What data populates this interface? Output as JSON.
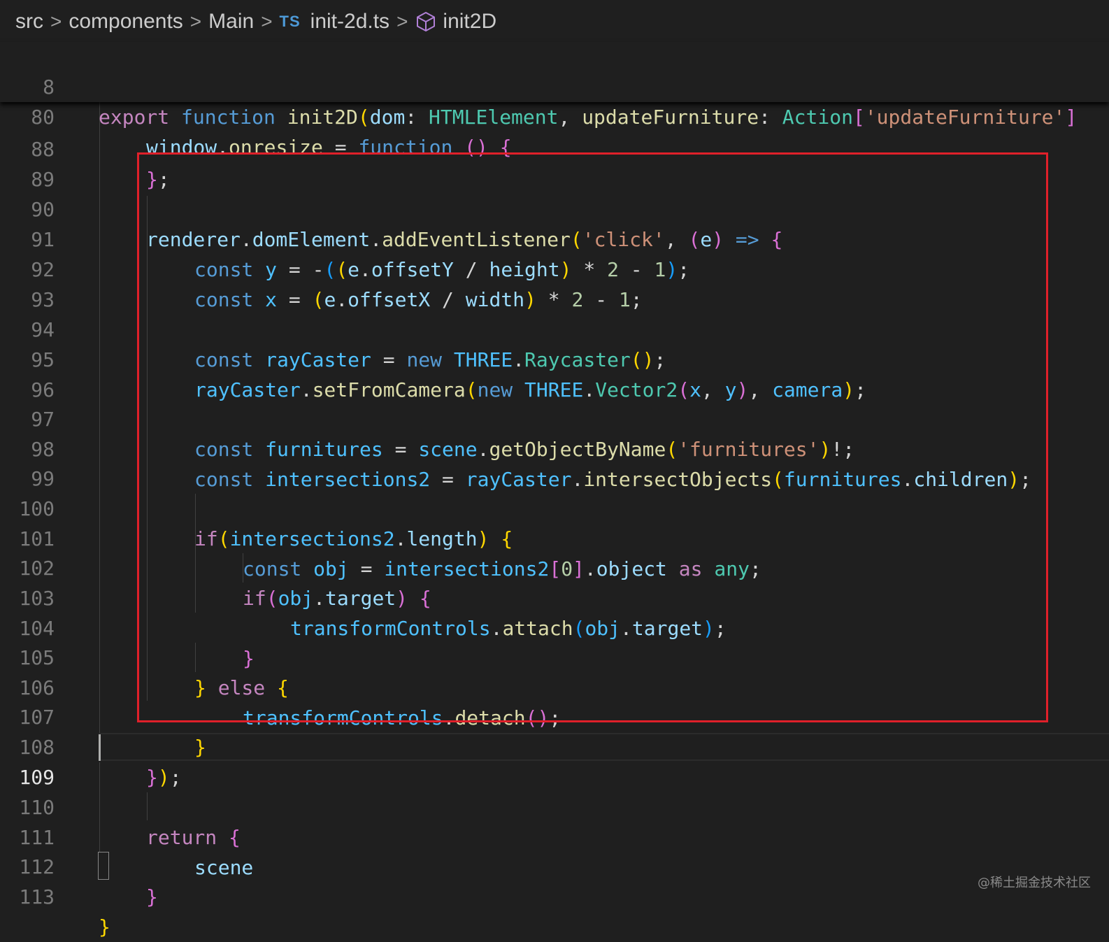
{
  "breadcrumb": {
    "items": [
      "src",
      "components",
      "Main"
    ],
    "file_badge": "TS",
    "file": "init-2d.ts",
    "symbol": "init2D",
    "separator": ">"
  },
  "editor": {
    "highlight_color": "#e0202a",
    "active_line": "109",
    "line_numbers": {
      "l8": "8",
      "l80": "80",
      "l88": "88",
      "l89": "89",
      "l90": "90",
      "l91": "91",
      "l92": "92",
      "l93": "93",
      "l94": "94",
      "l95": "95",
      "l96": "96",
      "l97": "97",
      "l98": "98",
      "l99": "99",
      "l100": "100",
      "l101": "101",
      "l102": "102",
      "l103": "103",
      "l104": "104",
      "l105": "105",
      "l106": "106",
      "l107": "107",
      "l108": "108",
      "l109": "109",
      "l110": "110",
      "l111": "111",
      "l112": "112",
      "l113": "113"
    },
    "code": {
      "l8": [
        "export",
        " ",
        "function",
        " ",
        "init2D",
        "(",
        "dom",
        ": ",
        "HTMLElement",
        ", ",
        "updateFurniture",
        ": ",
        "Action",
        "[",
        "'updateFurniture'",
        "]"
      ],
      "l80": [
        "window",
        ".",
        "onresize",
        " = ",
        "function",
        " ",
        "()",
        " ",
        "{"
      ],
      "l88": [
        "}",
        ";"
      ],
      "l90": [
        "renderer",
        ".",
        "domElement",
        ".",
        "addEventListener",
        "(",
        "'click'",
        ", ",
        "(",
        "e",
        ")",
        " ",
        "=>",
        " ",
        "{"
      ],
      "l91": [
        "const",
        " ",
        "y",
        " = ",
        "-",
        "(",
        "(",
        "e",
        ".",
        "offsetY",
        " / ",
        "height",
        ")",
        " * ",
        "2",
        " - ",
        "1",
        ")",
        ";"
      ],
      "l92": [
        "const",
        " ",
        "x",
        " = ",
        "(",
        "e",
        ".",
        "offsetX",
        " / ",
        "width",
        ")",
        " * ",
        "2",
        " - ",
        "1",
        ";"
      ],
      "l94": [
        "const",
        " ",
        "rayCaster",
        " = ",
        "new",
        " ",
        "THREE",
        ".",
        "Raycaster",
        "(",
        ")",
        ";"
      ],
      "l95": [
        "rayCaster",
        ".",
        "setFromCamera",
        "(",
        "new",
        " ",
        "THREE",
        ".",
        "Vector2",
        "(",
        "x",
        ", ",
        "y",
        ")",
        ", ",
        "camera",
        ")",
        ";"
      ],
      "l97": [
        "const",
        " ",
        "furnitures",
        " = ",
        "scene",
        ".",
        "getObjectByName",
        "(",
        "'furnitures'",
        ")",
        "!",
        ";"
      ],
      "l98": [
        "const",
        " ",
        "intersections2",
        " = ",
        "rayCaster",
        ".",
        "intersectObjects",
        "(",
        "furnitures",
        ".",
        "children",
        ")",
        ";"
      ],
      "l100": [
        "if",
        "(",
        "intersections2",
        ".",
        "length",
        ")",
        " ",
        "{"
      ],
      "l101": [
        "const",
        " ",
        "obj",
        " = ",
        "intersections2",
        "[",
        "0",
        "]",
        ".",
        "object",
        " ",
        "as",
        " ",
        "any",
        ";"
      ],
      "l102": [
        "if",
        "(",
        "obj",
        ".",
        "target",
        ")",
        " ",
        "{"
      ],
      "l103": [
        "transformControls",
        ".",
        "attach",
        "(",
        "obj",
        ".",
        "target",
        ")",
        ";"
      ],
      "l104": [
        "}"
      ],
      "l105": [
        "}",
        " ",
        "else",
        " ",
        "{"
      ],
      "l106": [
        "transformControls",
        ".",
        "detach",
        "(",
        ")",
        ";"
      ],
      "l107": [
        "}"
      ],
      "l108": [
        "}",
        ")",
        ";"
      ],
      "l110": [
        "return",
        " ",
        "{"
      ],
      "l111": [
        "scene"
      ],
      "l112": [
        "}"
      ],
      "l113": [
        "}"
      ]
    }
  },
  "watermark": "@稀土掘金技术社区"
}
